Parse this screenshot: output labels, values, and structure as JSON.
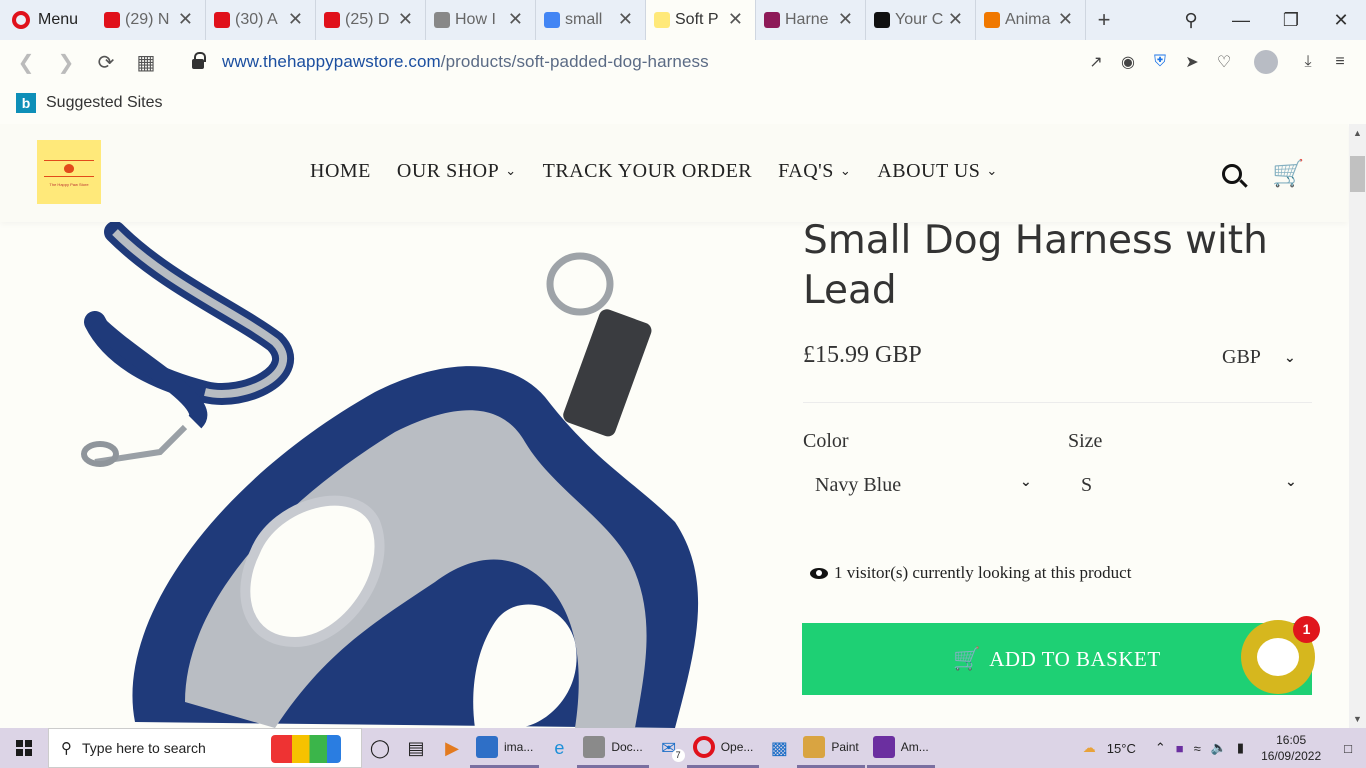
{
  "browser": {
    "menu_label": "Menu",
    "tabs": [
      {
        "label": "(29) N",
        "favicon": "opera-g-icon",
        "color": "#e0111b",
        "active": false
      },
      {
        "label": "(30) A",
        "favicon": "opera-g-icon",
        "color": "#e0111b",
        "active": false
      },
      {
        "label": "(25) D",
        "favicon": "opera-g-icon",
        "color": "#e0111b",
        "active": false
      },
      {
        "label": "How I",
        "favicon": "dog-icon",
        "color": "#888888",
        "active": false
      },
      {
        "label": "small",
        "favicon": "google-icon",
        "color": "#4285f4",
        "active": false
      },
      {
        "label": "Soft P",
        "favicon": "happypaw-icon",
        "color": "#ffe97a",
        "active": true
      },
      {
        "label": "Harne",
        "favicon": "heart-shield-icon",
        "color": "#8e1a58",
        "active": false
      },
      {
        "label": "Your C",
        "favicon": "amazon-icon",
        "color": "#111111",
        "active": false
      },
      {
        "label": "Anima",
        "favicon": "anima-icon",
        "color": "#f07800",
        "active": false
      }
    ],
    "url_domain": "www.thehappypawstore.com",
    "url_path": "/products/soft-padded-dog-harness",
    "bookmark_label": "Suggested Sites"
  },
  "site": {
    "logo_text": "The Happy Paw Store",
    "nav": [
      {
        "label": "HOME",
        "dropdown": false
      },
      {
        "label": "OUR SHOP",
        "dropdown": true
      },
      {
        "label": "TRACK YOUR ORDER",
        "dropdown": false
      },
      {
        "label": "FAQ'S",
        "dropdown": true
      },
      {
        "label": "ABOUT US",
        "dropdown": true
      }
    ]
  },
  "product": {
    "title": "Small Dog Harness with Lead",
    "price": "£15.99 GBP",
    "currency": "GBP",
    "color_label": "Color",
    "color_value": "Navy Blue",
    "size_label": "Size",
    "size_value": "S",
    "visitors_text": "1 visitor(s) currently looking at this product",
    "add_to_basket": "ADD TO BASKET",
    "accent_color": "#1ed074"
  },
  "chat": {
    "badge_count": "1",
    "color": "#d6b71e"
  },
  "taskbar": {
    "search_placeholder": "Type here to search",
    "apps": [
      {
        "label": "ima...",
        "icon": "photos-icon",
        "color": "#2e6fc7"
      },
      {
        "label": "Doc...",
        "icon": "document-icon",
        "color": "#8a8a8a"
      },
      {
        "label": "Ope...",
        "icon": "opera-icon",
        "color": "#e0111b"
      },
      {
        "label": "Paint",
        "icon": "paint-icon",
        "color": "#d9a441"
      },
      {
        "label": "Am...",
        "icon": "amazon-music-icon",
        "color": "#6b2fa0"
      }
    ],
    "mail_badge": "7",
    "temperature": "15°C",
    "time": "16:05",
    "date": "16/09/2022"
  }
}
